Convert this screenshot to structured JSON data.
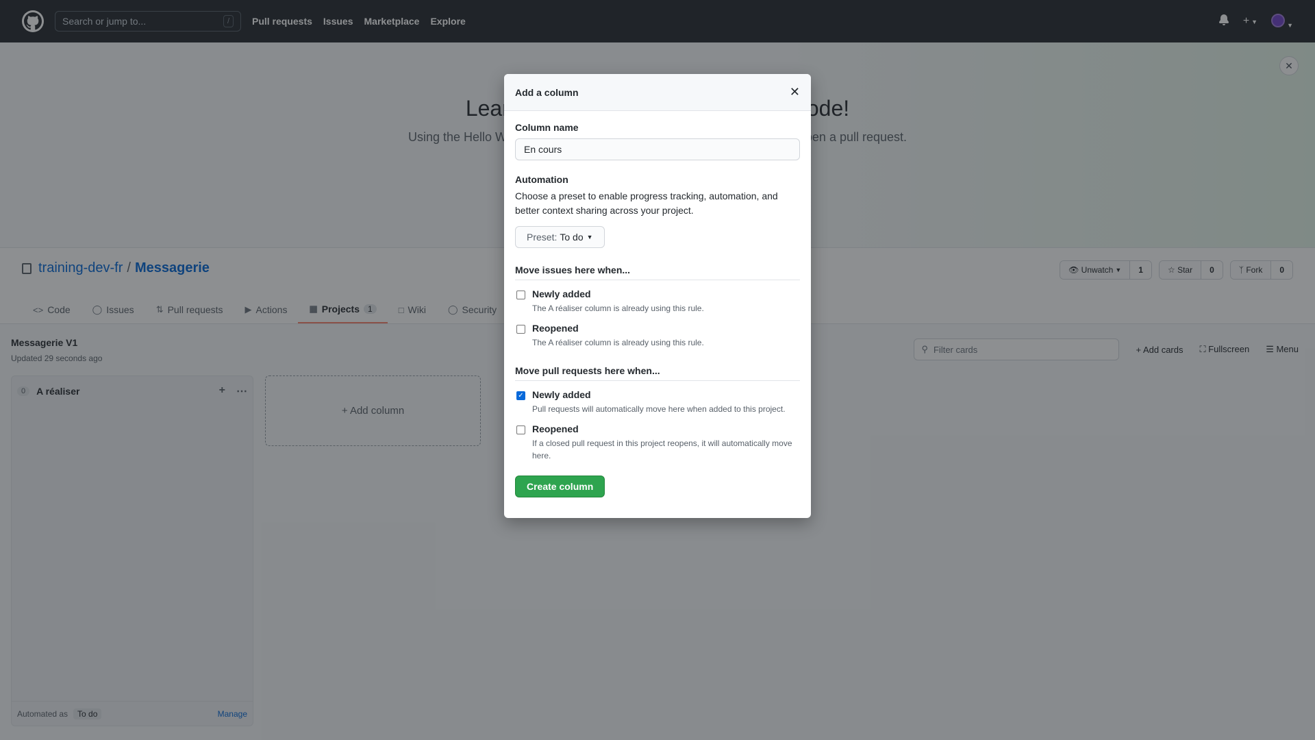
{
  "header": {
    "search_placeholder": "Search or jump to...",
    "search_shortcut": "/",
    "nav": [
      "Pull requests",
      "Issues",
      "Marketplace",
      "Explore"
    ]
  },
  "banner": {
    "title": "Learn Git and GitHub without any code!",
    "subtitle": "Using the Hello World guide, you’ll start a branch, write comments, and open a pull request."
  },
  "repo": {
    "owner": "training-dev-fr",
    "separator": "/",
    "name": "Messagerie",
    "unwatch_label": "Unwatch",
    "watch_count": "1",
    "star_label": "Star",
    "star_count": "0",
    "fork_label": "Fork",
    "fork_count": "0"
  },
  "tabs": [
    {
      "label": "Code"
    },
    {
      "label": "Issues"
    },
    {
      "label": "Pull requests"
    },
    {
      "label": "Actions"
    },
    {
      "label": "Projects",
      "count": "1"
    },
    {
      "label": "Wiki"
    },
    {
      "label": "Security"
    }
  ],
  "project": {
    "title": "Messagerie V1",
    "updated": "Updated 29 seconds ago",
    "filter_placeholder": "Filter cards",
    "add_cards": "Add cards",
    "fullscreen": "Fullscreen",
    "menu": "Menu",
    "column": {
      "count": "0",
      "name": "A réaliser",
      "automated_as": "Automated as",
      "automation_tag": "To do",
      "manage": "Manage"
    },
    "add_column": "+ Add column"
  },
  "modal": {
    "title": "Add a column",
    "column_name_label": "Column name",
    "column_name_value": "En cours",
    "automation_label": "Automation",
    "automation_desc": "Choose a preset to enable progress tracking, automation, and better context sharing across your project.",
    "preset_key": "Preset:",
    "preset_value": "To do",
    "issues_section": "Move issues here when...",
    "issues_rules": [
      {
        "title": "Newly added",
        "desc": "The A réaliser column is already using this rule.",
        "checked": false
      },
      {
        "title": "Reopened",
        "desc": "The A réaliser column is already using this rule.",
        "checked": false
      }
    ],
    "prs_section": "Move pull requests here when...",
    "prs_rules": [
      {
        "title": "Newly added",
        "desc": "Pull requests will automatically move here when added to this project.",
        "checked": true
      },
      {
        "title": "Reopened",
        "desc": "If a closed pull request in this project reopens, it will automatically move here.",
        "checked": false
      }
    ],
    "create_button": "Create column"
  }
}
